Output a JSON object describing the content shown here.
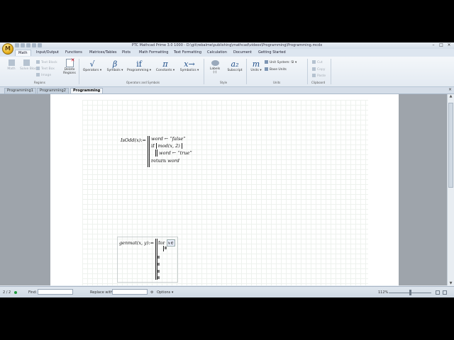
{
  "window": {
    "app_logo": "M",
    "title": "PTC Mathcad Prime 3.0 1000 - D:\\git\\rebalme\\publishing\\mathcad\\videos\\Programming\\Programming.mcdx",
    "controls": [
      "–",
      "□",
      "×"
    ]
  },
  "ribbon_tabs": [
    "Math",
    "Input/Output",
    "Functions",
    "Matrices/Tables",
    "Plots",
    "Math Formatting",
    "Text Formatting",
    "Calculation",
    "Document",
    "Getting Started"
  ],
  "ribbon": {
    "regions": {
      "math_label": "Math",
      "solve_label": "Solve Block",
      "text_block": "Text Block",
      "text_box": "Text Box",
      "image": "Image",
      "delete_regions_line1": "Delete",
      "delete_regions_line2": "Regions",
      "group_label": "Regions"
    },
    "operators_symbols": {
      "operators_label": "Operators",
      "operators_glyph": "√",
      "symbols_label": "Symbols",
      "symbols_glyph": "β",
      "programming_label": "Programming",
      "programming_glyph": "if",
      "constants_label": "Constants",
      "constants_glyph": "π",
      "symbolics_label": "Symbolics",
      "symbolics_glyph": "x→",
      "group_label": "Operators and Symbols"
    },
    "style": {
      "labels_label": "Labels",
      "labels_sub": "(-)",
      "subscript_label": "Subscript",
      "subscript_glyph": "a₂",
      "group_label": "Style"
    },
    "units": {
      "units_label": "Units",
      "units_glyph": "m",
      "unit_system": "Unit System: SI",
      "base_units": "Base Units",
      "group_label": "Units"
    },
    "clipboard": {
      "cut": "Cut",
      "copy": "Copy",
      "paste": "Paste",
      "group_label": "Clipboard"
    }
  },
  "document_tabs": [
    "Programming1",
    "Programming2",
    "Programming"
  ],
  "document_tabs_close": "×",
  "worksheet": {
    "isodd": {
      "lhs": "IsOdd(x)",
      "define": ":=",
      "line1": "word ← “false”",
      "line2_kw": "if",
      "line2_expr": "mod(x, 2)",
      "line3": "word ← “true”",
      "line4_kw": "return",
      "line4_var": "word"
    },
    "genmat": {
      "lhs": "genmat(x, y)",
      "define": ":=",
      "for_kw": "for",
      "for_var": "x",
      "in_sym": "∈"
    }
  },
  "statusbar": {
    "page": "2 / 2",
    "find_label": "Find:",
    "find_value": "",
    "replace_label": "Replace with:",
    "replace_value": "",
    "options_label": "Options",
    "zoom": "112%"
  }
}
